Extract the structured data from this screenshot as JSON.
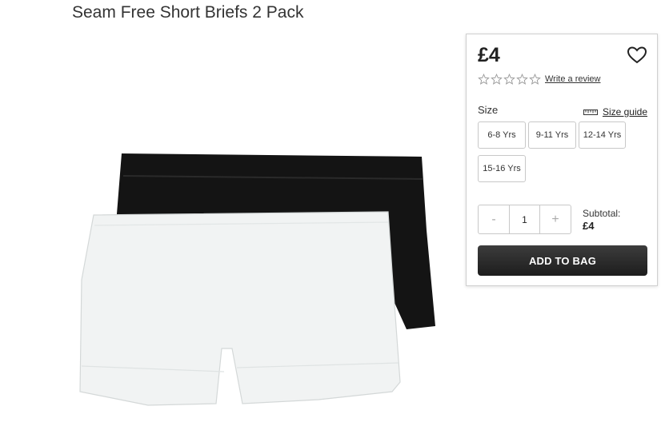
{
  "product": {
    "title": "Seam Free Short Briefs 2 Pack",
    "price": "£4",
    "rating_stars": 0,
    "write_review": "Write a review"
  },
  "size": {
    "label": "Size",
    "guide": "Size guide",
    "options": [
      "6-8 Yrs",
      "9-11 Yrs",
      "12-14 Yrs",
      "15-16 Yrs"
    ]
  },
  "quantity": {
    "minus": "-",
    "value": "1",
    "plus": "+"
  },
  "subtotal": {
    "label": "Subtotal:",
    "amount": "£4"
  },
  "actions": {
    "add_to_bag": "ADD TO BAG"
  },
  "icons": {
    "wishlist": "heart-icon",
    "star": "star-outline-icon",
    "size_guide": "ruler-icon"
  },
  "colors": {
    "button_dark": "#262626",
    "border": "#c8c8c8",
    "brief_black": "#141414",
    "brief_white": "#f1f3f3"
  }
}
